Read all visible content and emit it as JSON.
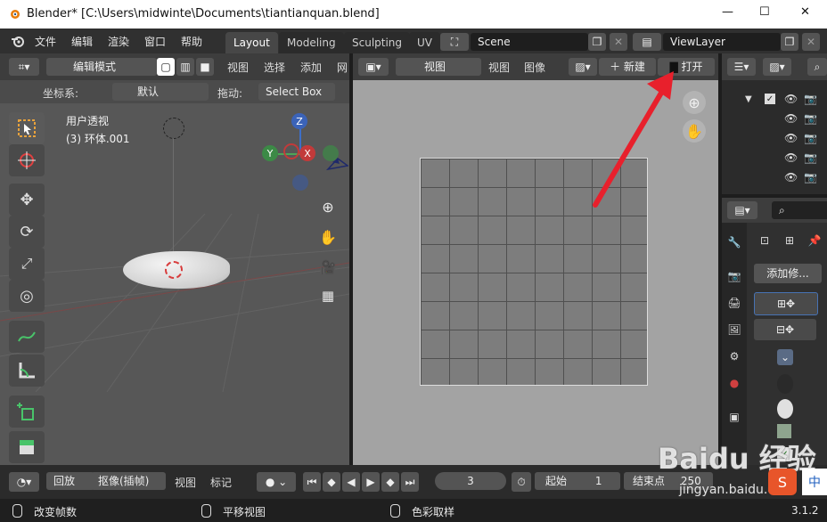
{
  "window": {
    "title": "Blender* [C:\\Users\\midwinte\\Documents\\tiantianquan.blend]",
    "min": "—",
    "max": "☐",
    "close": "✕"
  },
  "menu": {
    "file": "文件",
    "edit": "编辑",
    "render": "渲染",
    "window": "窗口",
    "help": "帮助"
  },
  "workspaces": [
    "Layout",
    "Modeling",
    "Sculpting",
    "UV"
  ],
  "scene": {
    "name": "Scene"
  },
  "view_layer": {
    "name": "ViewLayer"
  },
  "viewport3d": {
    "mode": "编辑模式",
    "menus": [
      "视图",
      "选择",
      "添加",
      "网"
    ],
    "coord_label": "坐标系:",
    "coord_value": "默认",
    "drag_label": "拖动:",
    "drag_value": "Select Box",
    "view_name": "用户透视",
    "object_name": "(3) 环体.001",
    "axis": {
      "z": "Z",
      "y": "Y",
      "x": "X"
    }
  },
  "image_editor": {
    "view": "视图",
    "menus": [
      "视图",
      "图像"
    ],
    "new_label": "新建",
    "open_label": "打开"
  },
  "properties": {
    "add_modifier": "添加修..."
  },
  "timeline": {
    "playback": "回放",
    "keying": "抠像(插帧)",
    "view": "视图",
    "marker": "标记",
    "current_frame": "3",
    "start_label": "起始",
    "start_value": "1",
    "end_label": "结束点",
    "end_value": "250"
  },
  "statusbar": {
    "change_frame": "改变帧数",
    "pan_view": "平移视图",
    "color_sample": "色彩取样",
    "version": "3.1.2"
  },
  "watermark": {
    "brand": "Baidu 经验",
    "url": "jingyan.baidu.com",
    "ime": "中"
  },
  "colors": {
    "accent": "#4772b3",
    "arrow": "#e8202c",
    "header": "#3d3d3d"
  }
}
